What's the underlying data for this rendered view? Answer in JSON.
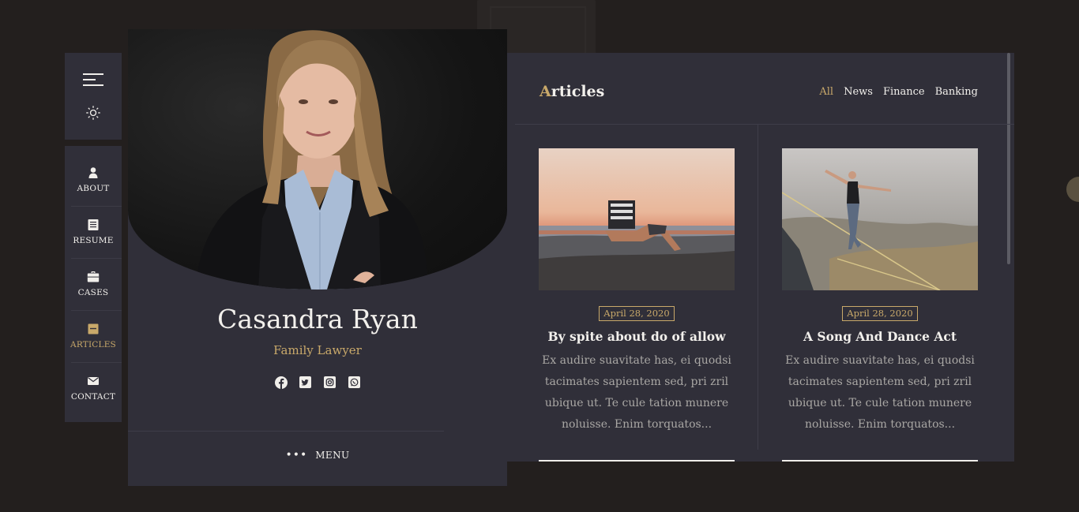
{
  "nav": {
    "items": [
      {
        "label": "ABOUT",
        "icon": "person-icon"
      },
      {
        "label": "RESUME",
        "icon": "document-icon"
      },
      {
        "label": "CASES",
        "icon": "briefcase-icon"
      },
      {
        "label": "ARTICLES",
        "icon": "article-icon",
        "active": true
      },
      {
        "label": "CONTACT",
        "icon": "envelope-icon"
      }
    ]
  },
  "profile": {
    "name": "Casandra Ryan",
    "role": "Family Lawyer",
    "socials": [
      "facebook-icon",
      "twitter-icon",
      "instagram-icon",
      "whatsapp-icon"
    ],
    "menu_label": "MENU"
  },
  "articles": {
    "title_first": "A",
    "title_rest": "rticles",
    "filters": [
      "All",
      "News",
      "Finance",
      "Banking"
    ],
    "active_filter": "All",
    "cards": [
      {
        "date": "April 28, 2020",
        "title": "By spite about do of allow",
        "excerpt": "Ex audire suavitate has, ei quodsi tacimates sapientem sed, pri zril ubique ut. Te cule tation munere noluisse. Enim torquatos..."
      },
      {
        "date": "April 28, 2020",
        "title": "A Song And Dance Act",
        "excerpt": "Ex audire suavitate has, ei quodsi tacimates sapientem sed, pri zril ubique ut. Te cule tation munere noluisse. Enim torquatos..."
      }
    ]
  },
  "colors": {
    "accent": "#c9a96a",
    "panel": "#302f39",
    "background": "#231f1e"
  }
}
